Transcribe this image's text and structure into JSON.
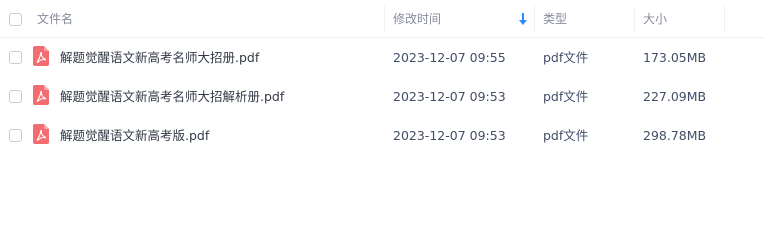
{
  "header": {
    "name_label": "文件名",
    "time_label": "修改时间",
    "type_label": "类型",
    "size_label": "大小"
  },
  "sort": {
    "icon": "sort-down-arrow-icon",
    "color": "#2a8cff"
  },
  "file_icon": {
    "icon": "pdf-file-icon",
    "color": "#f36c6f"
  },
  "files": [
    {
      "name": "解题觉醒语文新高考名师大招册.pdf",
      "modified": "2023-12-07 09:55",
      "type": "pdf文件",
      "size": "173.05MB"
    },
    {
      "name": "解题觉醒语文新高考名师大招解析册.pdf",
      "modified": "2023-12-07 09:53",
      "type": "pdf文件",
      "size": "227.09MB"
    },
    {
      "name": "解题觉醒语文新高考版.pdf",
      "modified": "2023-12-07 09:53",
      "type": "pdf文件",
      "size": "298.78MB"
    }
  ]
}
